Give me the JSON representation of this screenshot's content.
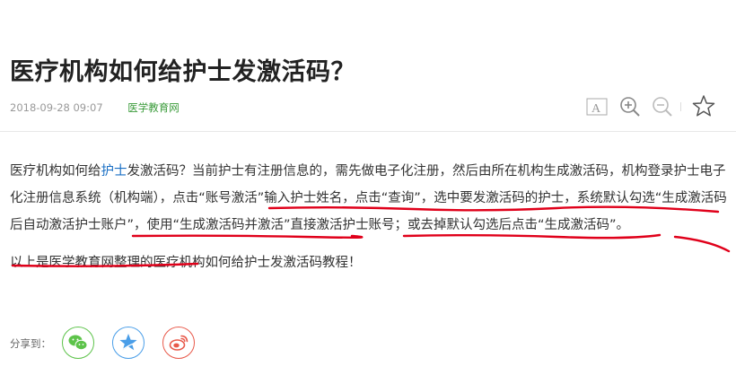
{
  "article": {
    "title": "医疗机构如何给护士发激活码？",
    "date": "2018-09-28 09:07",
    "source": "医学教育网"
  },
  "toolbar": {
    "font_size_icon": "font-size-icon",
    "zoom_in_icon": "zoom-in-icon",
    "zoom_out_icon": "zoom-out-icon",
    "favorite_icon": "star-icon"
  },
  "body": {
    "p1": {
      "s1": "医疗机构如何给",
      "link": "护士",
      "s2": "发激活码？当前护士有注册信息的，需先做电子化注册，然后由所在机构生成激活码，机构登录护士电子化注册信息系统（机构端），点击“账号激活”输入护士姓名，点击“查询”，选中要发激活码的护士，系统默认勾选“生成激活码后自动激活护士账户”，使用“生成激活码并激活”直接激活护士账号；或去掉默认勾选后点击“生成激活码”。"
    },
    "p2": "以上是医学教育网整理的医疗机构如何给护士发激活码教程！"
  },
  "share": {
    "label": "分享到：",
    "services": [
      {
        "name": "wechat",
        "color": "#5dc34a"
      },
      {
        "name": "qzone",
        "color": "#4a9ee8"
      },
      {
        "name": "weibo",
        "color": "#e8594a"
      }
    ]
  },
  "annotation_color": "#e0001a"
}
